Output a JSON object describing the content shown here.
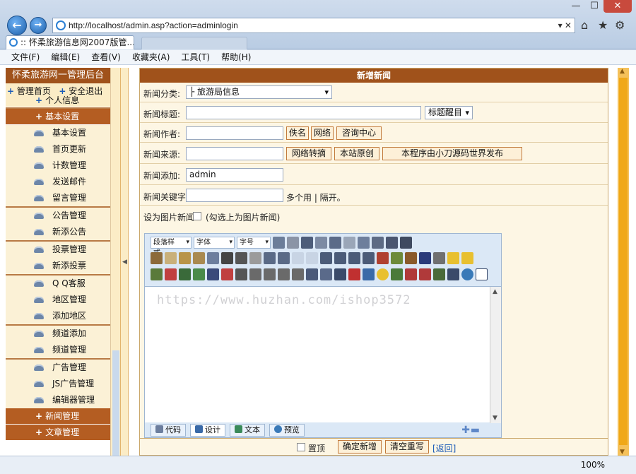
{
  "browser": {
    "url": "http://localhost/admin.asp?action=adminlogin",
    "tab_title": ":: 怀柔旅游信息网2007版管...",
    "back": "←",
    "forward": "→",
    "addr_tools": "▾ ✕",
    "win_min": "—",
    "win_max": "☐",
    "win_close": "✕",
    "home_icon": "⌂",
    "star_icon": "★",
    "gear_icon": "⚙",
    "zoom": "100%"
  },
  "menubar": {
    "items": [
      "文件(F)",
      "编辑(E)",
      "查看(V)",
      "收藏夹(A)",
      "工具(T)",
      "帮助(H)"
    ]
  },
  "sidebar": {
    "title": "怀柔旅游网一管理后台",
    "link_home": "管理首页",
    "link_logout": "安全退出",
    "sections": {
      "personal": "个人信息",
      "basic": "基本设置",
      "news": "新闻管理",
      "article": "文章管理"
    },
    "items": {
      "i0": "基本设置",
      "i1": "首页更新",
      "i2": "计数管理",
      "i3": "发送邮件",
      "i4": "留言管理",
      "i5": "公告管理",
      "i6": "新添公告",
      "i7": "投票管理",
      "i8": "新添投票",
      "i9": "Q Q客服",
      "i10": "地区管理",
      "i11": "添加地区",
      "i12": "频道添加",
      "i13": "频道管理",
      "i14": "广告管理",
      "i15": "JS广告管理",
      "i16": "编辑器管理"
    }
  },
  "form": {
    "title": "新增新闻",
    "category_label": "新闻分类:",
    "category_value": "├ 旅游局信息",
    "title_label": "新闻标题:",
    "title_style_value": "标题醒目",
    "author_label": "新闻作者:",
    "author_btn_anon": "佚名",
    "author_btn_web": "网络",
    "author_btn_consult": "咨询中心",
    "source_label": "新闻来源:",
    "source_btn_repost": "网络转摘",
    "source_btn_original": "本站原创",
    "source_btn_program": "本程序由小刀源码世界发布",
    "adder_label": "新闻添加:",
    "adder_value": "admin",
    "keyword_label": "新闻关键字",
    "keyword_hint": "多个用 | 隔开。",
    "image_news_label": "设为图片新闻",
    "image_news_hint": "(勾选上为图片新闻)",
    "confirm_btn": "确定新增",
    "reset_btn": "清空重写",
    "back_link": "[返回]",
    "top_label": "置顶"
  },
  "editor": {
    "dd_format": "段落样式",
    "dd_font": "字体",
    "dd_size": "字号",
    "mode_code": "代码",
    "mode_design": "设计",
    "mode_text": "文本",
    "mode_preview": "预览",
    "plus": "✚",
    "minus": "▬"
  },
  "watermark": "https://www.huzhan.com/ishop3572",
  "colors": {
    "header_brown": "#a0521b",
    "sidebar_cream": "#fbecc6",
    "scroll_orange": "#f0a818"
  }
}
